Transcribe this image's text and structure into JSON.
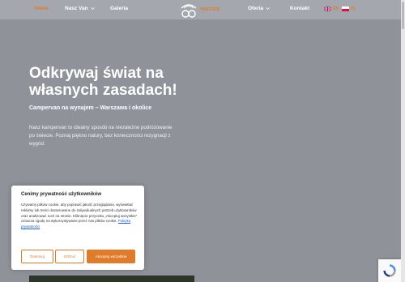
{
  "nav": {
    "items": [
      {
        "label": "Home"
      },
      {
        "label": "Nasz Van"
      },
      {
        "label": "Galeria"
      },
      {
        "label": "Oferta"
      },
      {
        "label": "Kontakt"
      }
    ],
    "logo_text": "VANTOUR",
    "languages": [
      {
        "code": "EN",
        "icon": "uk-flag-icon"
      },
      {
        "code": "PL",
        "icon": "pl-flag-icon"
      }
    ],
    "colors": {
      "accent": "#e07b2a",
      "nav_bg": "#a4a7ae"
    }
  },
  "hero": {
    "title": "Odkrywaj świat na własnych zasadach!",
    "subtitle": "Campervan na wynajem – Warszawa i okolice",
    "description": "Nasz kampervan to idealny sposób na niezależne podróżowanie po świecie. Poznaj piękno natury, bez konieczności rezygnacji z wygód."
  },
  "cookie": {
    "title": "Cenimy prywatność użytkowników",
    "text": "Używamy plików cookie, aby poprawić jakość przeglądania, wyświetlać reklamy lub treści dostosowane do indywidualnych potrzeb użytkowników oraz analizować ruch na stronie. Kliknięcie przycisku „Akceptuj wszystkie” oznacza zgodę na wykorzystywanie przez nas plików cookie.",
    "link": "Polityka prywatności",
    "buttons": {
      "customize": "Dostosuj",
      "reject": "Odrzuć",
      "accept": "Akceptuj wszystkie"
    }
  }
}
